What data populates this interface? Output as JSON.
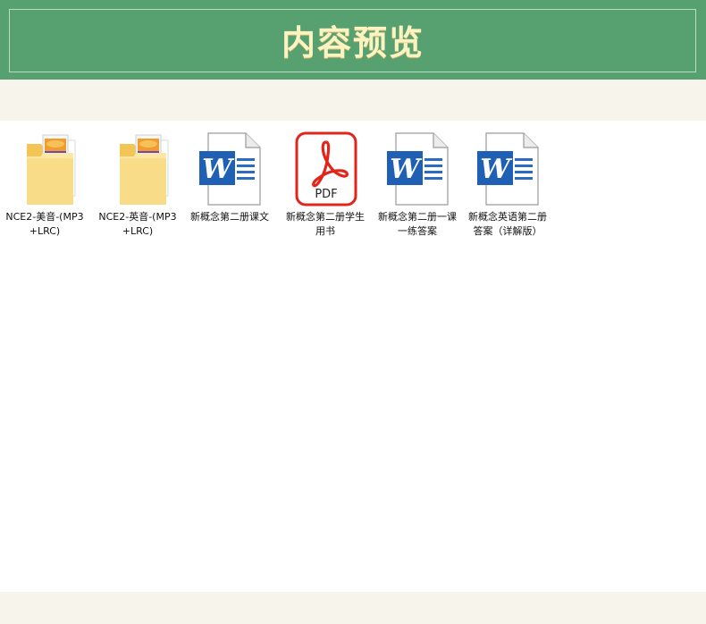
{
  "header": {
    "title": "内容预览"
  },
  "files": [
    {
      "name": "NCE2-美音-(MP3+LRC)",
      "type": "folder",
      "icon": "folder-icon"
    },
    {
      "name": "NCE2-英音-(MP3+LRC)",
      "type": "folder",
      "icon": "folder-icon"
    },
    {
      "name": "新概念第二册课文",
      "type": "word",
      "icon": "word-doc-icon"
    },
    {
      "name": "新概念第二册学生用书",
      "type": "pdf",
      "icon": "pdf-icon",
      "icon_text": "PDF"
    },
    {
      "name": "新概念第二册一课一练答案",
      "type": "word",
      "icon": "word-doc-icon"
    },
    {
      "name": "新概念英语第二册答案（详解版）",
      "type": "word",
      "icon": "word-doc-icon"
    }
  ],
  "colors": {
    "banner": "#57a06f",
    "title": "#fbf3c2",
    "band": "#f7f4ec",
    "word_blue": "#1f5fb4",
    "pdf_red": "#e1251b"
  }
}
